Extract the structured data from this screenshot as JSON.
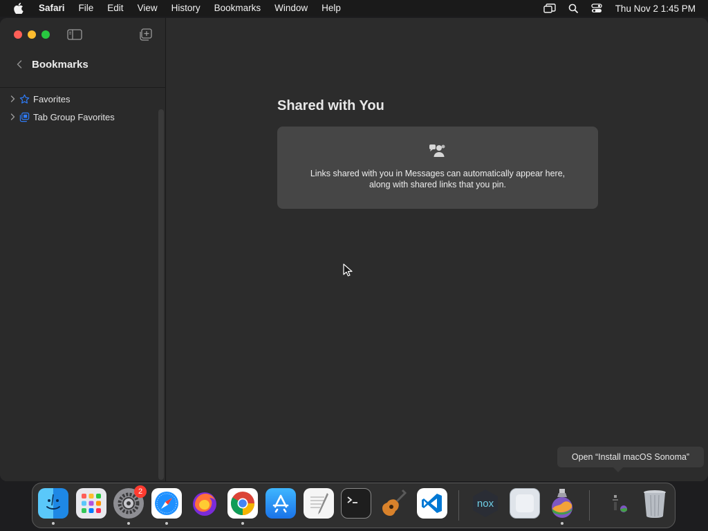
{
  "menubar": {
    "app_name": "Safari",
    "menus": [
      "File",
      "Edit",
      "View",
      "History",
      "Bookmarks",
      "Window",
      "Help"
    ],
    "clock": "Thu Nov 2  1:45 PM"
  },
  "sidebar": {
    "title": "Bookmarks",
    "items": [
      {
        "label": "Favorites",
        "icon": "star-icon"
      },
      {
        "label": "Tab Group Favorites",
        "icon": "tab-group-icon"
      }
    ]
  },
  "main": {
    "section_title": "Shared with You",
    "shared_description": "Links shared with you in Messages can automatically appear here, along with shared links that you pin."
  },
  "tooltip": {
    "text": "Open “Install macOS Sonoma”"
  },
  "dock": {
    "settings_badge": "2"
  },
  "colors": {
    "accent": "#2f7bf6",
    "close": "#ff5f57",
    "minimize": "#febc2e",
    "maximize": "#28c840",
    "badge": "#ff3b30"
  }
}
